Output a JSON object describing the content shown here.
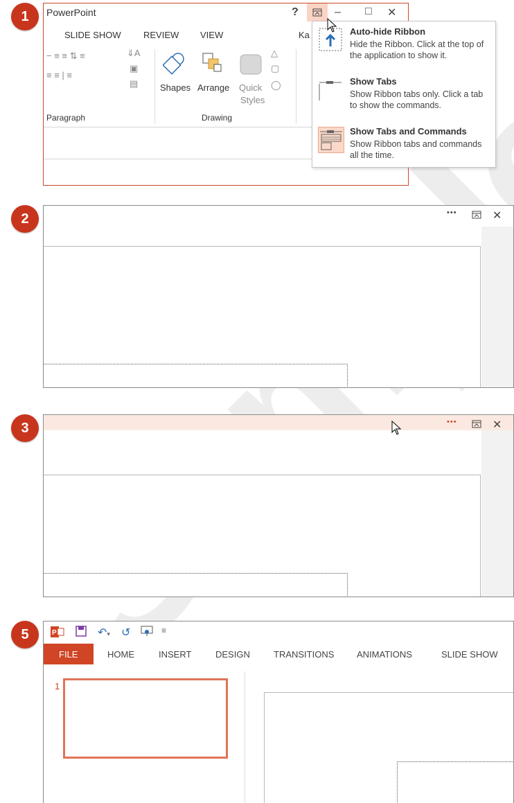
{
  "steps": [
    "1",
    "2",
    "3",
    "5"
  ],
  "panel1": {
    "app_title": "PowerPoint",
    "help": "?",
    "tabs": [
      "SLIDE SHOW",
      "REVIEW",
      "VIEW",
      "Ka"
    ],
    "groups": {
      "paragraph": "Paragraph",
      "drawing": "Drawing"
    },
    "buttons": {
      "shapes": "Shapes",
      "arrange": "Arrange",
      "quick": "Quick",
      "styles": "Styles"
    },
    "menu": [
      {
        "title": "Auto-hide Ribbon",
        "desc": "Hide the Ribbon. Click at the top of the application to show it."
      },
      {
        "title": "Show Tabs",
        "desc": "Show Ribbon tabs only. Click a tab to show the commands."
      },
      {
        "title": "Show Tabs and Commands",
        "desc": "Show Ribbon tabs and commands all the time."
      }
    ]
  },
  "panel_controls": {
    "more": "•••",
    "close": "✕"
  },
  "panel5": {
    "tabs": [
      "FILE",
      "HOME",
      "INSERT",
      "DESIGN",
      "TRANSITIONS",
      "ANIMATIONS",
      "SLIDE SHOW"
    ],
    "thumb_number": "1"
  },
  "colors": {
    "accent": "#d04525",
    "badge": "#c8351d",
    "highlight": "#fbd8c7"
  }
}
